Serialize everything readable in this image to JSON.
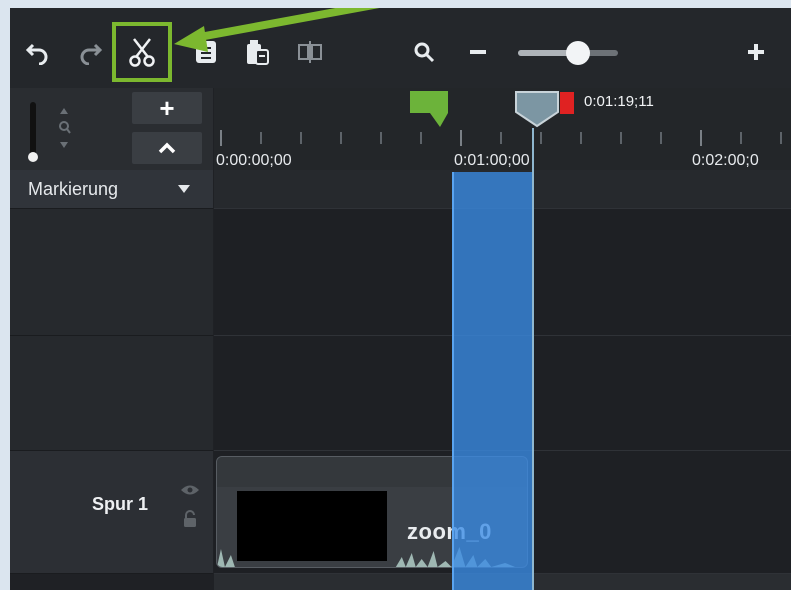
{
  "toolbar": {
    "buttons": [
      "undo-icon",
      "redo-icon",
      "scissors-icon",
      "copy-icon",
      "paste-icon",
      "split-icon",
      "search-icon",
      "zoom-out-icon",
      "zoom-in-icon"
    ],
    "zoom_level": 0.6,
    "highlight_color": "#7cb82f"
  },
  "left_panel": {
    "add_label": "+",
    "collapse_label": "^",
    "marker_track_label": "Markierung",
    "track1_label": "Spur 1"
  },
  "ruler": {
    "timecodes": [
      "0:00:00;00",
      "0:01:00;00",
      "0:02:00;0"
    ],
    "playhead_time": "0:01:19;11"
  },
  "clip": {
    "name": "zoom_0"
  },
  "colors": {
    "selection": "#3a8ce6",
    "marker": "#6cb33a",
    "out_point": "#e02222",
    "playhead": "#7c96a3"
  }
}
